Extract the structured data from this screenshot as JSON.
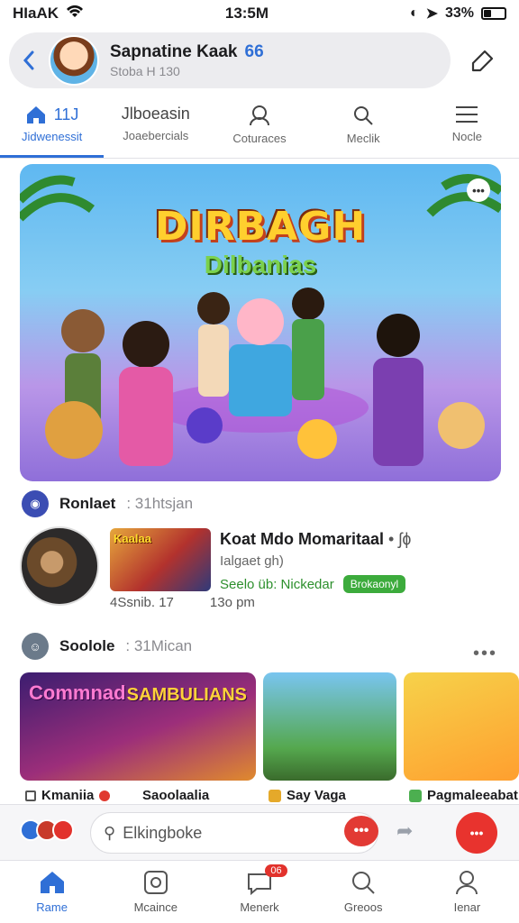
{
  "status_bar": {
    "carrier": "HIaAK",
    "time": "13:5M",
    "battery": "33%"
  },
  "header": {
    "name": "Sapnatine Kaak",
    "count": "66",
    "subtitle": "Stoba H 130"
  },
  "tabs": [
    {
      "top": "11J",
      "label": "Jidwenessit"
    },
    {
      "top": "Jlboeasin",
      "label": "Joaebercials"
    },
    {
      "top": "",
      "label": "Coturaces"
    },
    {
      "top": "",
      "label": "Meclik"
    },
    {
      "top": "",
      "label": "Nocle"
    }
  ],
  "hero": {
    "title": "DIRBAGH",
    "subtitle": "Dilbanias"
  },
  "post1": {
    "name": "Ronlaet",
    "meta": ": 31htsjan"
  },
  "feed": {
    "thumb_text": "Kaalaa",
    "line1": "Koat Mdo Momaritaal",
    "line1_suffix": "• ʃɸ",
    "line2": "Ialgaet gh)",
    "line3": "Seelo üb: Nickedar",
    "badge": "Brokaonyl",
    "stat1": "4Ssnib. 17",
    "stat2": "13o pm"
  },
  "post2": {
    "name": "Soolole",
    "meta": ": 31Mican"
  },
  "cards": [
    {
      "overlay_left": "Commnad",
      "overlay_right": "SAMBULIANS",
      "caption_a": "Kmaniia",
      "caption_b": "Saoolaalia"
    },
    {
      "caption": "Say Vaga"
    },
    {
      "caption": "Pagmaleeabat"
    }
  ],
  "input": {
    "placeholder": "Elkingboke"
  },
  "nav": [
    {
      "label": "Rame",
      "icon": "home-icon"
    },
    {
      "label": "Mcaince",
      "icon": "media-icon"
    },
    {
      "label": "Menerk",
      "icon": "chat-icon",
      "badge": "06"
    },
    {
      "label": "Greoos",
      "icon": "search-icon"
    },
    {
      "label": "Ienar",
      "icon": "profile-icon"
    }
  ],
  "colors": {
    "accent": "#2f6fd6",
    "danger": "#e2322c",
    "success": "#3cab3c"
  }
}
